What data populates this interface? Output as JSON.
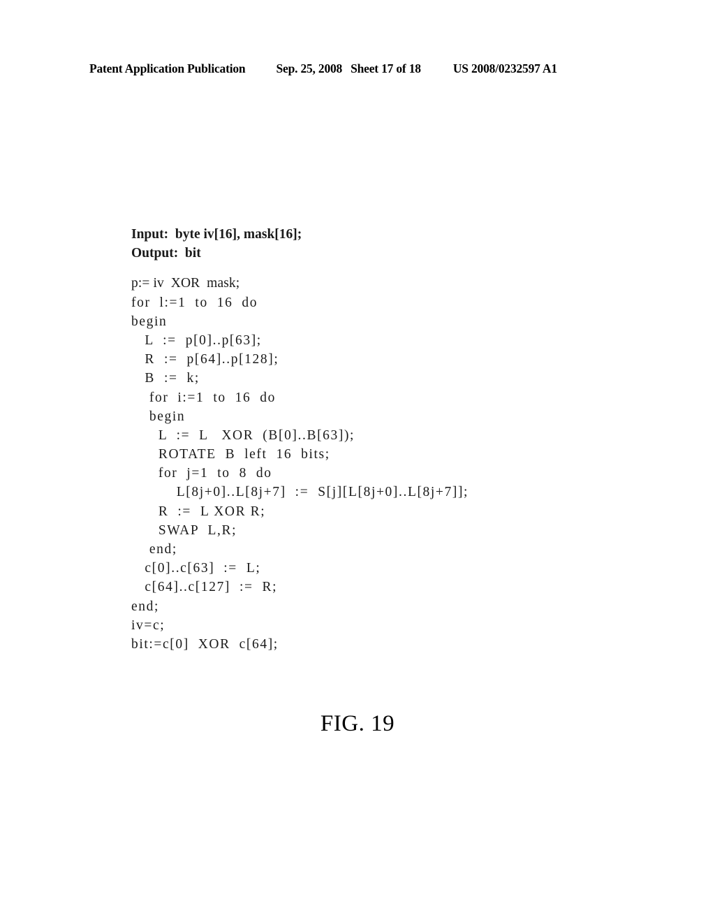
{
  "header": {
    "publication": "Patent Application Publication",
    "date": "Sep. 25, 2008",
    "sheet": "Sheet 17 of 18",
    "patent_number": "US 2008/0232597 A1"
  },
  "figure": {
    "caption": "FIG. 19"
  },
  "code": {
    "lines": [
      {
        "text": "Input:  byte iv[16], mask[16];",
        "style": "io"
      },
      {
        "text": "Output:  bit",
        "style": "io"
      },
      {
        "text": "",
        "style": "blank"
      },
      {
        "text": "p:= iv  XOR  mask;",
        "style": "normal"
      },
      {
        "text": "for  l:=1  to  16  do",
        "style": "loose"
      },
      {
        "text": "begin",
        "style": "loose"
      },
      {
        "text": "   L  :=  p[0]..p[63];",
        "style": "loose"
      },
      {
        "text": "   R  :=  p[64]..p[128];",
        "style": "loose"
      },
      {
        "text": "   B  :=  k;",
        "style": "loose"
      },
      {
        "text": "    for  i:=1  to  16  do",
        "style": "loose"
      },
      {
        "text": "    begin",
        "style": "loose"
      },
      {
        "text": "      L  :=  L   XOR  (B[0]..B[63]);",
        "style": "loose"
      },
      {
        "text": "      ROTATE  B  left  16  bits;",
        "style": "loose"
      },
      {
        "text": "      for  j=1  to  8  do",
        "style": "loose"
      },
      {
        "text": "          L[8j+0]..L[8j+7]  :=  S[j][L[8j+0]..L[8j+7]];",
        "style": "loose"
      },
      {
        "text": "      R  :=  L XOR R;",
        "style": "loose"
      },
      {
        "text": "      SWAP  L,R;",
        "style": "loose"
      },
      {
        "text": "    end;",
        "style": "loose"
      },
      {
        "text": "   c[0]..c[63]  :=  L;",
        "style": "loose"
      },
      {
        "text": "   c[64]..c[127]  :=  R;",
        "style": "loose"
      },
      {
        "text": "end;",
        "style": "loose"
      },
      {
        "text": "iv=c;",
        "style": "loose"
      },
      {
        "text": "bit:=c[0]  XOR  c[64];",
        "style": "loose"
      }
    ]
  }
}
